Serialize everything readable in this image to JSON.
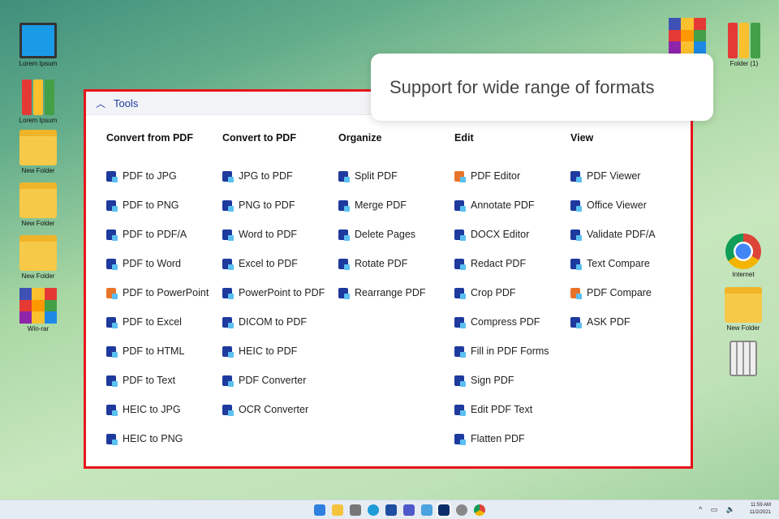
{
  "desktop": {
    "left": [
      {
        "label": "Lorem Ipsum",
        "icon": "computer-icon"
      },
      {
        "label": "Lorem Ipsum",
        "icon": "binders-icon"
      },
      {
        "label": "New Folder",
        "icon": "folder-icon"
      },
      {
        "label": "New Folder",
        "icon": "folder-icon"
      },
      {
        "label": "New Folder",
        "icon": "folder-icon"
      },
      {
        "label": "Win-rar",
        "icon": "winrar-icon"
      }
    ],
    "right": [
      {
        "label": "",
        "icon": "winrar-icon"
      },
      {
        "label": "Folder (1)",
        "icon": "binders-icon"
      },
      {
        "label": "Internet",
        "icon": "chrome-icon"
      },
      {
        "label": "New Folder",
        "icon": "folder-icon"
      },
      {
        "label": "",
        "icon": "recycle-bin-icon"
      }
    ]
  },
  "tooltip": "Support for wide range of formats",
  "panel": {
    "title": "Tools",
    "columns": [
      {
        "heading": "Convert from PDF",
        "items": [
          "PDF to JPG",
          "PDF to PNG",
          "PDF to PDF/A",
          "PDF to Word",
          "PDF to PowerPoint",
          "PDF to Excel",
          "PDF to HTML",
          "PDF to Text",
          "HEIC to JPG",
          "HEIC to PNG"
        ]
      },
      {
        "heading": "Convert to PDF",
        "items": [
          "JPG to PDF",
          "PNG to PDF",
          "Word to PDF",
          "Excel to PDF",
          "PowerPoint to PDF",
          "DICOM to PDF",
          "HEIC to PDF",
          "PDF Converter",
          "OCR Converter"
        ]
      },
      {
        "heading": "Organize",
        "items": [
          "Split PDF",
          "Merge PDF",
          "Delete Pages",
          "Rotate PDF",
          "Rearrange PDF"
        ]
      },
      {
        "heading": "Edit",
        "items": [
          "PDF Editor",
          "Annotate PDF",
          "DOCX Editor",
          "Redact PDF",
          "Crop PDF",
          "Compress PDF",
          "Fill in PDF Forms",
          "Sign PDF",
          "Edit PDF Text",
          "Flatten PDF"
        ]
      },
      {
        "heading": "View",
        "items": [
          "PDF Viewer",
          "Office Viewer",
          "Validate PDF/A",
          "Text Compare",
          "PDF Compare",
          "ASK PDF"
        ]
      }
    ]
  },
  "taskbar": {
    "time": "11:59 AM",
    "date": "11/2/2021"
  },
  "colors": {
    "accent": "#1e3a9e",
    "highlight": "#e8141b"
  }
}
